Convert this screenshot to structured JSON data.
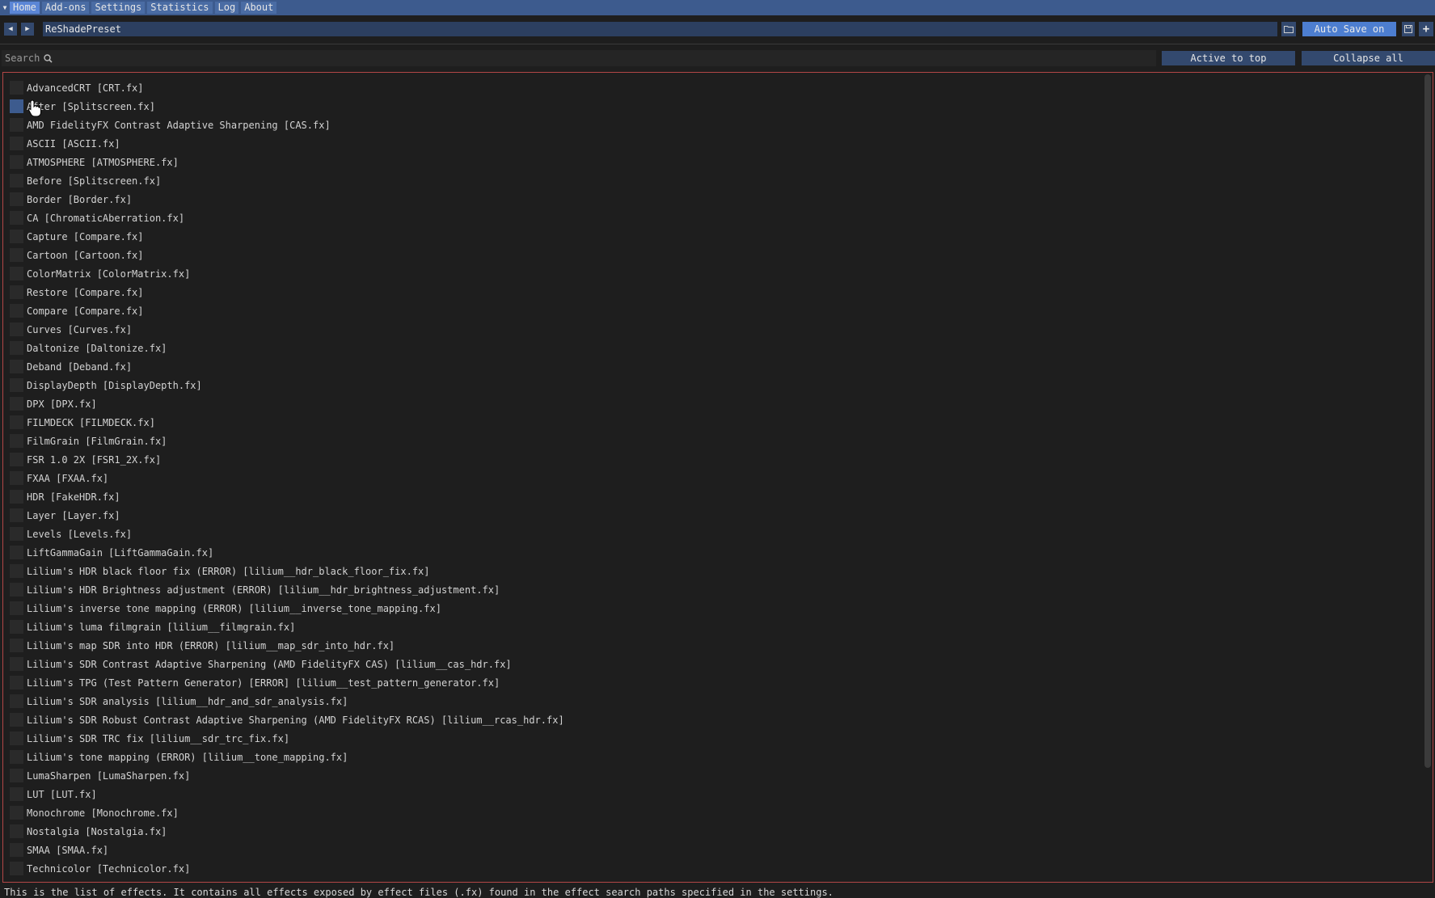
{
  "menu": {
    "tabs": [
      {
        "label": "Home",
        "active": true
      },
      {
        "label": "Add-ons",
        "active": false
      },
      {
        "label": "Settings",
        "active": false
      },
      {
        "label": "Statistics",
        "active": false
      },
      {
        "label": "Log",
        "active": false
      },
      {
        "label": "About",
        "active": false
      }
    ]
  },
  "preset": {
    "name": "ReShadePreset",
    "auto_save_label": "Auto Save on"
  },
  "search": {
    "placeholder": "Search",
    "active_to_top_label": "Active to top",
    "collapse_all_label": "Collapse all"
  },
  "effects": [
    "AdvancedCRT [CRT.fx]",
    "After [Splitscreen.fx]",
    "AMD FidelityFX Contrast Adaptive Sharpening [CAS.fx]",
    "ASCII [ASCII.fx]",
    "ATMOSPHERE [ATMOSPHERE.fx]",
    "Before [Splitscreen.fx]",
    "Border [Border.fx]",
    "CA [ChromaticAberration.fx]",
    "Capture [Compare.fx]",
    "Cartoon [Cartoon.fx]",
    "ColorMatrix [ColorMatrix.fx]",
    "Restore [Compare.fx]",
    "Compare [Compare.fx]",
    "Curves [Curves.fx]",
    "Daltonize [Daltonize.fx]",
    "Deband [Deband.fx]",
    "DisplayDepth [DisplayDepth.fx]",
    "DPX [DPX.fx]",
    "FILMDECK [FILMDECK.fx]",
    "FilmGrain [FilmGrain.fx]",
    "FSR 1.0 2X [FSR1_2X.fx]",
    "FXAA [FXAA.fx]",
    "HDR [FakeHDR.fx]",
    "Layer [Layer.fx]",
    "Levels [Levels.fx]",
    "LiftGammaGain [LiftGammaGain.fx]",
    "Lilium's HDR black floor fix (ERROR) [lilium__hdr_black_floor_fix.fx]",
    "Lilium's HDR Brightness adjustment (ERROR) [lilium__hdr_brightness_adjustment.fx]",
    "Lilium's inverse tone mapping (ERROR) [lilium__inverse_tone_mapping.fx]",
    "Lilium's luma filmgrain [lilium__filmgrain.fx]",
    "Lilium's map SDR into HDR (ERROR) [lilium__map_sdr_into_hdr.fx]",
    "Lilium's SDR Contrast Adaptive Sharpening (AMD FidelityFX CAS) [lilium__cas_hdr.fx]",
    "Lilium's TPG (Test Pattern Generator) [ERROR] [lilium__test_pattern_generator.fx]",
    "Lilium's SDR analysis [lilium__hdr_and_sdr_analysis.fx]",
    "Lilium's SDR Robust Contrast Adaptive Sharpening (AMD FidelityFX RCAS) [lilium__rcas_hdr.fx]",
    "Lilium's SDR TRC fix [lilium__sdr_trc_fix.fx]",
    "Lilium's tone mapping (ERROR) [lilium__tone_mapping.fx]",
    "LumaSharpen [LumaSharpen.fx]",
    "LUT [LUT.fx]",
    "Monochrome [Monochrome.fx]",
    "Nostalgia [Nostalgia.fx]",
    "SMAA [SMAA.fx]",
    "Technicolor [Technicolor.fx]"
  ],
  "status_text": "This is the list of effects. It contains all effects exposed by effect files (.fx) found in the effect search paths specified in the settings.",
  "colors": {
    "accent": "#4d7ed0",
    "menu_bg": "#3d5b8e",
    "list_border": "#b24646"
  }
}
